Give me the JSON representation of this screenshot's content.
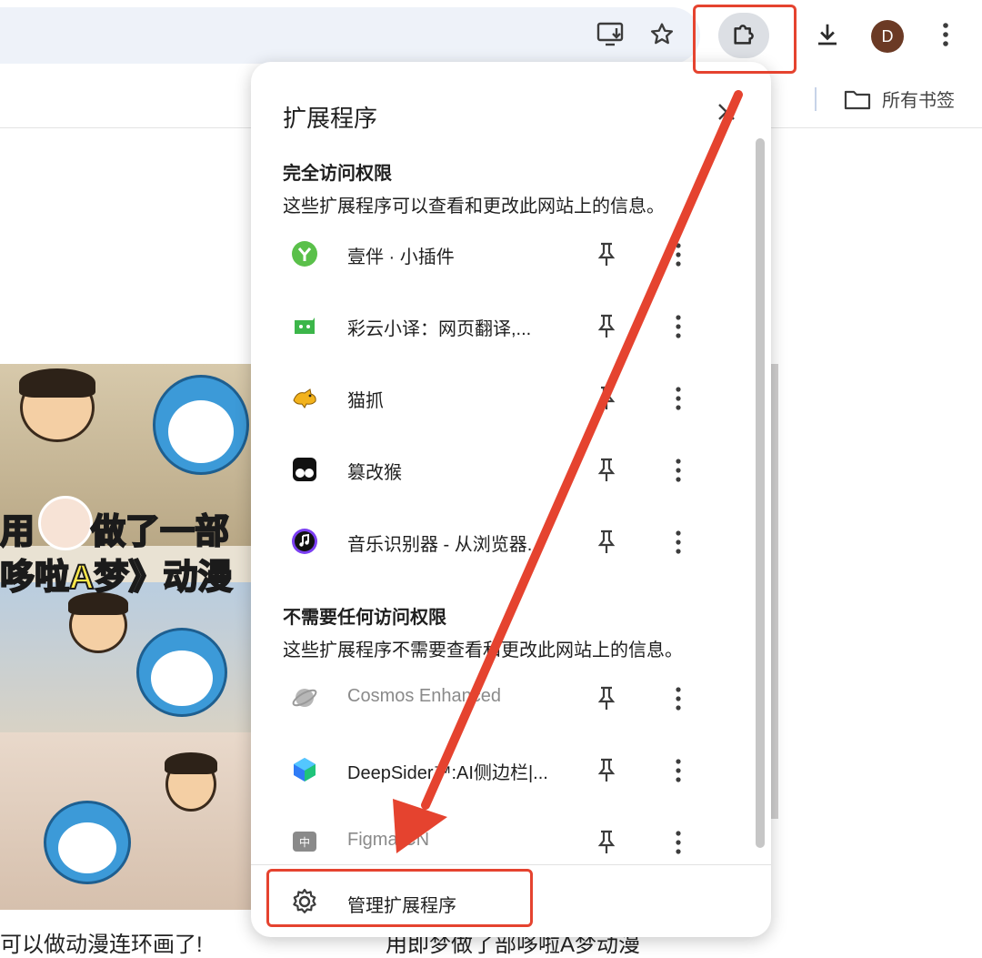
{
  "toolbar": {
    "icons": [
      "install-app-icon",
      "bookmark-star-icon",
      "extensions-puzzle-icon",
      "download-icon",
      "avatar",
      "more-vert-icon"
    ],
    "profile_initial": "D",
    "avatar_color": "#6b3a25"
  },
  "bookmarks": {
    "all_bookmarks_label": "所有书签"
  },
  "page": {
    "caption_line1": "用",
    "caption_line1b": "做了一部",
    "caption_line2": "哆啦A梦》动漫",
    "below_left": "可以做动漫连环画了!",
    "below_right": "用即梦做了部哆啦A梦动漫"
  },
  "popup": {
    "title": "扩展程序",
    "full_access": {
      "heading": "完全访问权限",
      "description": "这些扩展程序可以查看和更改此网站上的信息。",
      "items": [
        {
          "name": "壹伴 · 小插件",
          "icon": "yiban-icon",
          "color": "#5ac04a"
        },
        {
          "name": "彩云小译：网页翻译,...",
          "icon": "caiyun-icon",
          "color": "#3cb64a"
        },
        {
          "name": "猫抓",
          "icon": "maozhua-icon",
          "color": "#f2b21c"
        },
        {
          "name": "篡改猴",
          "icon": "tampermonkey-icon",
          "color": "#111111"
        },
        {
          "name": "音乐识别器 - 从浏览器...",
          "icon": "music-recognizer-icon",
          "color": "#7b3ff2"
        }
      ]
    },
    "no_access": {
      "heading": "不需要任何访问权限",
      "description": "这些扩展程序不需要查看和更改此网站上的信息。",
      "items": [
        {
          "name": "Cosmos Enhanced",
          "icon": "cosmos-icon",
          "color": "#9a9a9a",
          "disabled": true
        },
        {
          "name": "DeepSider™:AI侧边栏|...",
          "icon": "deepsider-icon",
          "color": "#2f7cf6",
          "disabled": false
        },
        {
          "name": "Figma CN",
          "icon": "figma-cn-icon",
          "color": "#8a8a8a",
          "disabled": true
        }
      ]
    },
    "manage_label": "管理扩展程序"
  },
  "annotation": {
    "highlight_color": "#e5432f"
  }
}
